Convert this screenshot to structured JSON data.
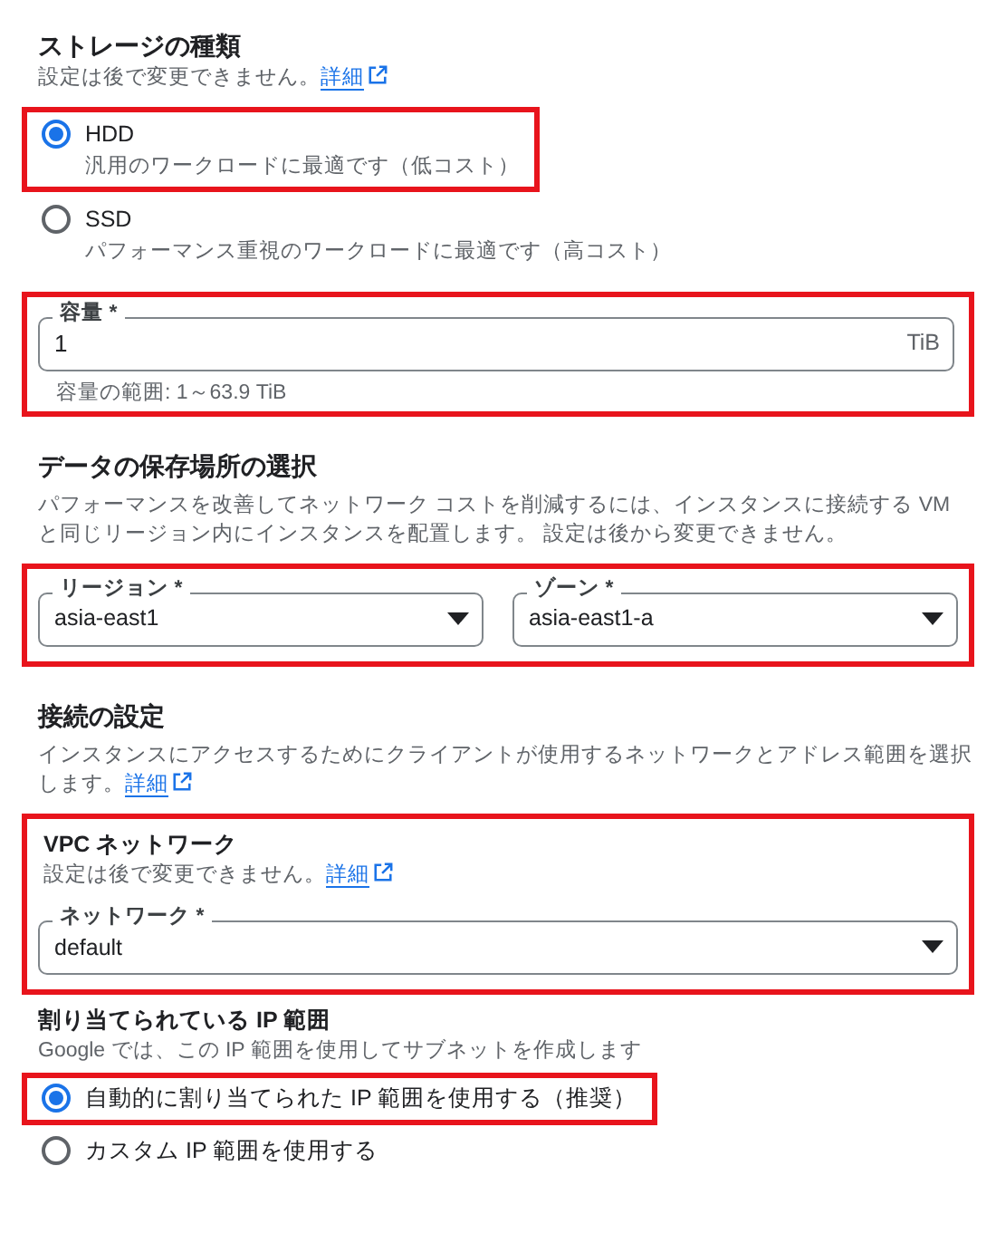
{
  "storage_type": {
    "title": "ストレージの種類",
    "description": "設定は後で変更できません。",
    "link": "詳細",
    "options": [
      {
        "label": "HDD",
        "description": "汎用のワークロードに最適です（低コスト）",
        "selected": true,
        "highlighted": true
      },
      {
        "label": "SSD",
        "description": "パフォーマンス重視のワークロードに最適です（高コスト）",
        "selected": false,
        "highlighted": false
      }
    ]
  },
  "capacity": {
    "label": "容量 *",
    "value": "1",
    "unit": "TiB",
    "helper": "容量の範囲: 1～63.9 TiB",
    "highlighted": true
  },
  "location": {
    "title": "データの保存場所の選択",
    "description": "パフォーマンスを改善してネットワーク コストを削減するには、インスタンスに接続する VM と同じリージョン内にインスタンスを配置します。 設定は後から変更できません。",
    "highlighted": true,
    "selects": [
      {
        "label": "リージョン *",
        "value": "asia-east1"
      },
      {
        "label": "ゾーン *",
        "value": "asia-east1-a"
      }
    ]
  },
  "connection": {
    "title": "接続の設定",
    "description": "インスタンスにアクセスするためにクライアントが使用するネットワークとアドレス範囲を選択します。",
    "link": "詳細"
  },
  "vpc": {
    "title": "VPC ネットワーク",
    "description": "設定は後で変更できません。",
    "link": "詳細",
    "highlighted": true,
    "select": {
      "label": "ネットワーク *",
      "value": "default"
    }
  },
  "ip_range": {
    "title": "割り当てられている IP 範囲",
    "description": "Google では、この IP 範囲を使用してサブネットを作成します",
    "options": [
      {
        "label": "自動的に割り当てられた IP 範囲を使用する（推奨）",
        "selected": true,
        "highlighted": true
      },
      {
        "label": "カスタム IP 範囲を使用する",
        "selected": false,
        "highlighted": false
      }
    ]
  }
}
